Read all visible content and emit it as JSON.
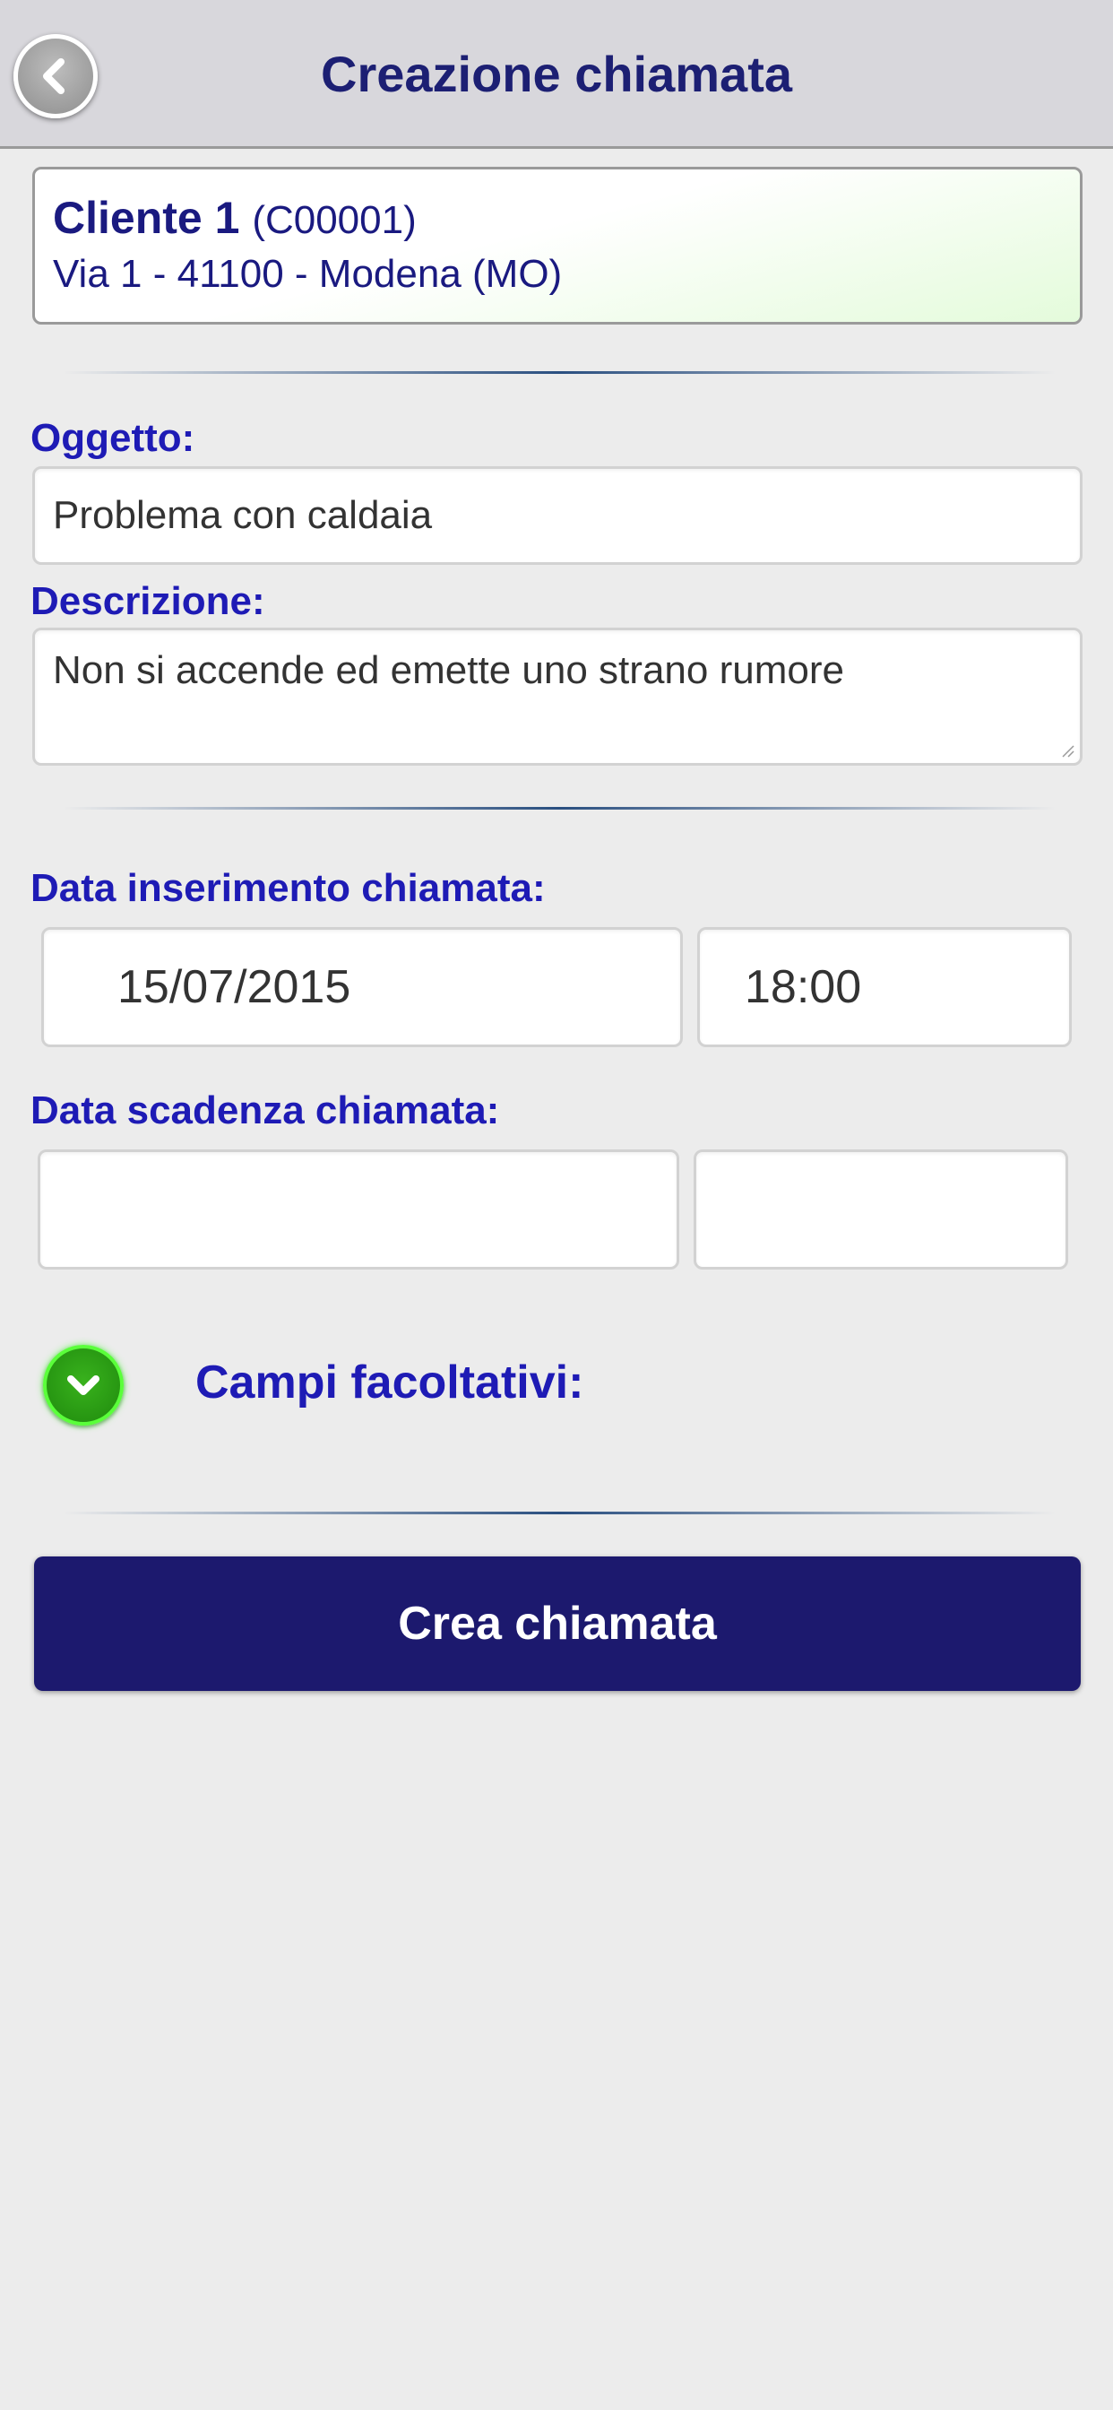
{
  "header": {
    "title": "Creazione chiamata",
    "back_icon": "chevron-left-icon"
  },
  "client": {
    "name": "Cliente 1",
    "code": "(C00001)",
    "address": "Via 1 - 41100 - Modena (MO)"
  },
  "form": {
    "subject_label": "Oggetto:",
    "subject_value": "Problema con caldaia",
    "description_label": "Descrizione:",
    "description_value": "Non si accende ed emette uno strano rumore",
    "insert_date_label": "Data inserimento chiamata:",
    "insert_date_value": "15/07/2015",
    "insert_time_value": "18:00",
    "due_date_label": "Data scadenza chiamata:",
    "due_date_value": "",
    "due_time_value": "",
    "optional_label": "Campi facoltativi:",
    "optional_icon": "chevron-down-icon"
  },
  "actions": {
    "submit_label": "Crea chiamata"
  },
  "colors": {
    "accent": "#1e1bb5",
    "title": "#1c1f73",
    "button": "#1c196e",
    "toggle": "#2ea017"
  }
}
